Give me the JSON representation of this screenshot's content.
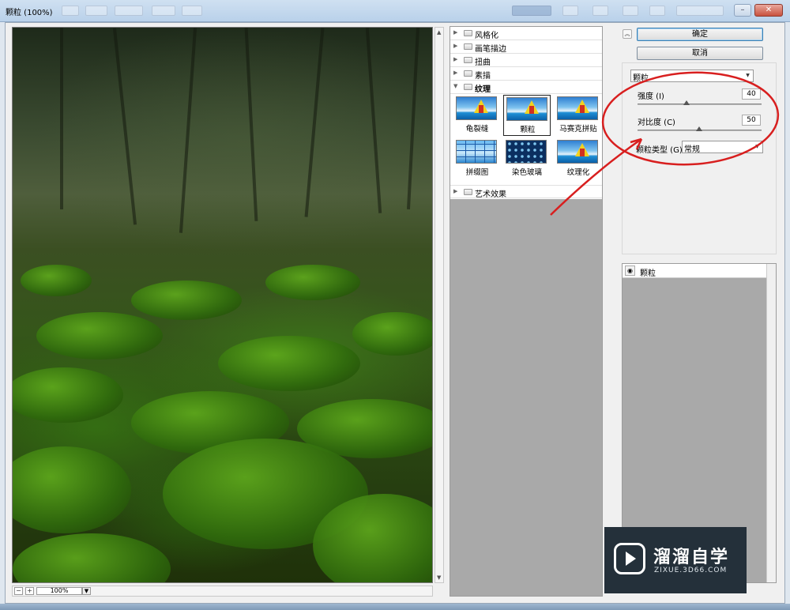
{
  "window": {
    "title": "颗粒 (100%)"
  },
  "preview": {
    "zoom": "100%",
    "zoom_out_icon": "minus-icon",
    "zoom_in_icon": "plus-icon"
  },
  "gallery": {
    "categories": [
      {
        "label": "风格化",
        "expanded": false
      },
      {
        "label": "画笔描边",
        "expanded": false
      },
      {
        "label": "扭曲",
        "expanded": false
      },
      {
        "label": "素描",
        "expanded": false
      },
      {
        "label": "纹理",
        "expanded": true
      },
      {
        "label": "艺术效果",
        "expanded": false
      }
    ],
    "texture_filters": [
      {
        "label": "龟裂缝",
        "selected": false
      },
      {
        "label": "颗粒",
        "selected": true
      },
      {
        "label": "马赛克拼贴",
        "selected": false
      },
      {
        "label": "拼缀图",
        "selected": false
      },
      {
        "label": "染色玻璃",
        "selected": false
      },
      {
        "label": "纹理化",
        "selected": false
      }
    ]
  },
  "buttons": {
    "ok": "确定",
    "cancel": "取消"
  },
  "settings": {
    "filter_select": "颗粒",
    "intensity": {
      "label": "强度 (I)",
      "value": "40"
    },
    "contrast": {
      "label": "对比度 (C)",
      "value": "50"
    },
    "grain_type": {
      "label": "颗粒类型 (G):",
      "value": "常规"
    }
  },
  "layers": {
    "items": [
      {
        "label": "颗粒",
        "visible": true
      }
    ]
  },
  "watermark": {
    "title": "溜溜自学",
    "url": "ZIXUE.3D66.COM"
  },
  "colors": {
    "annotation_red": "#d81f1f",
    "accent_blue": "#3c7fb1",
    "gray_panel": "#a9a9a9"
  }
}
